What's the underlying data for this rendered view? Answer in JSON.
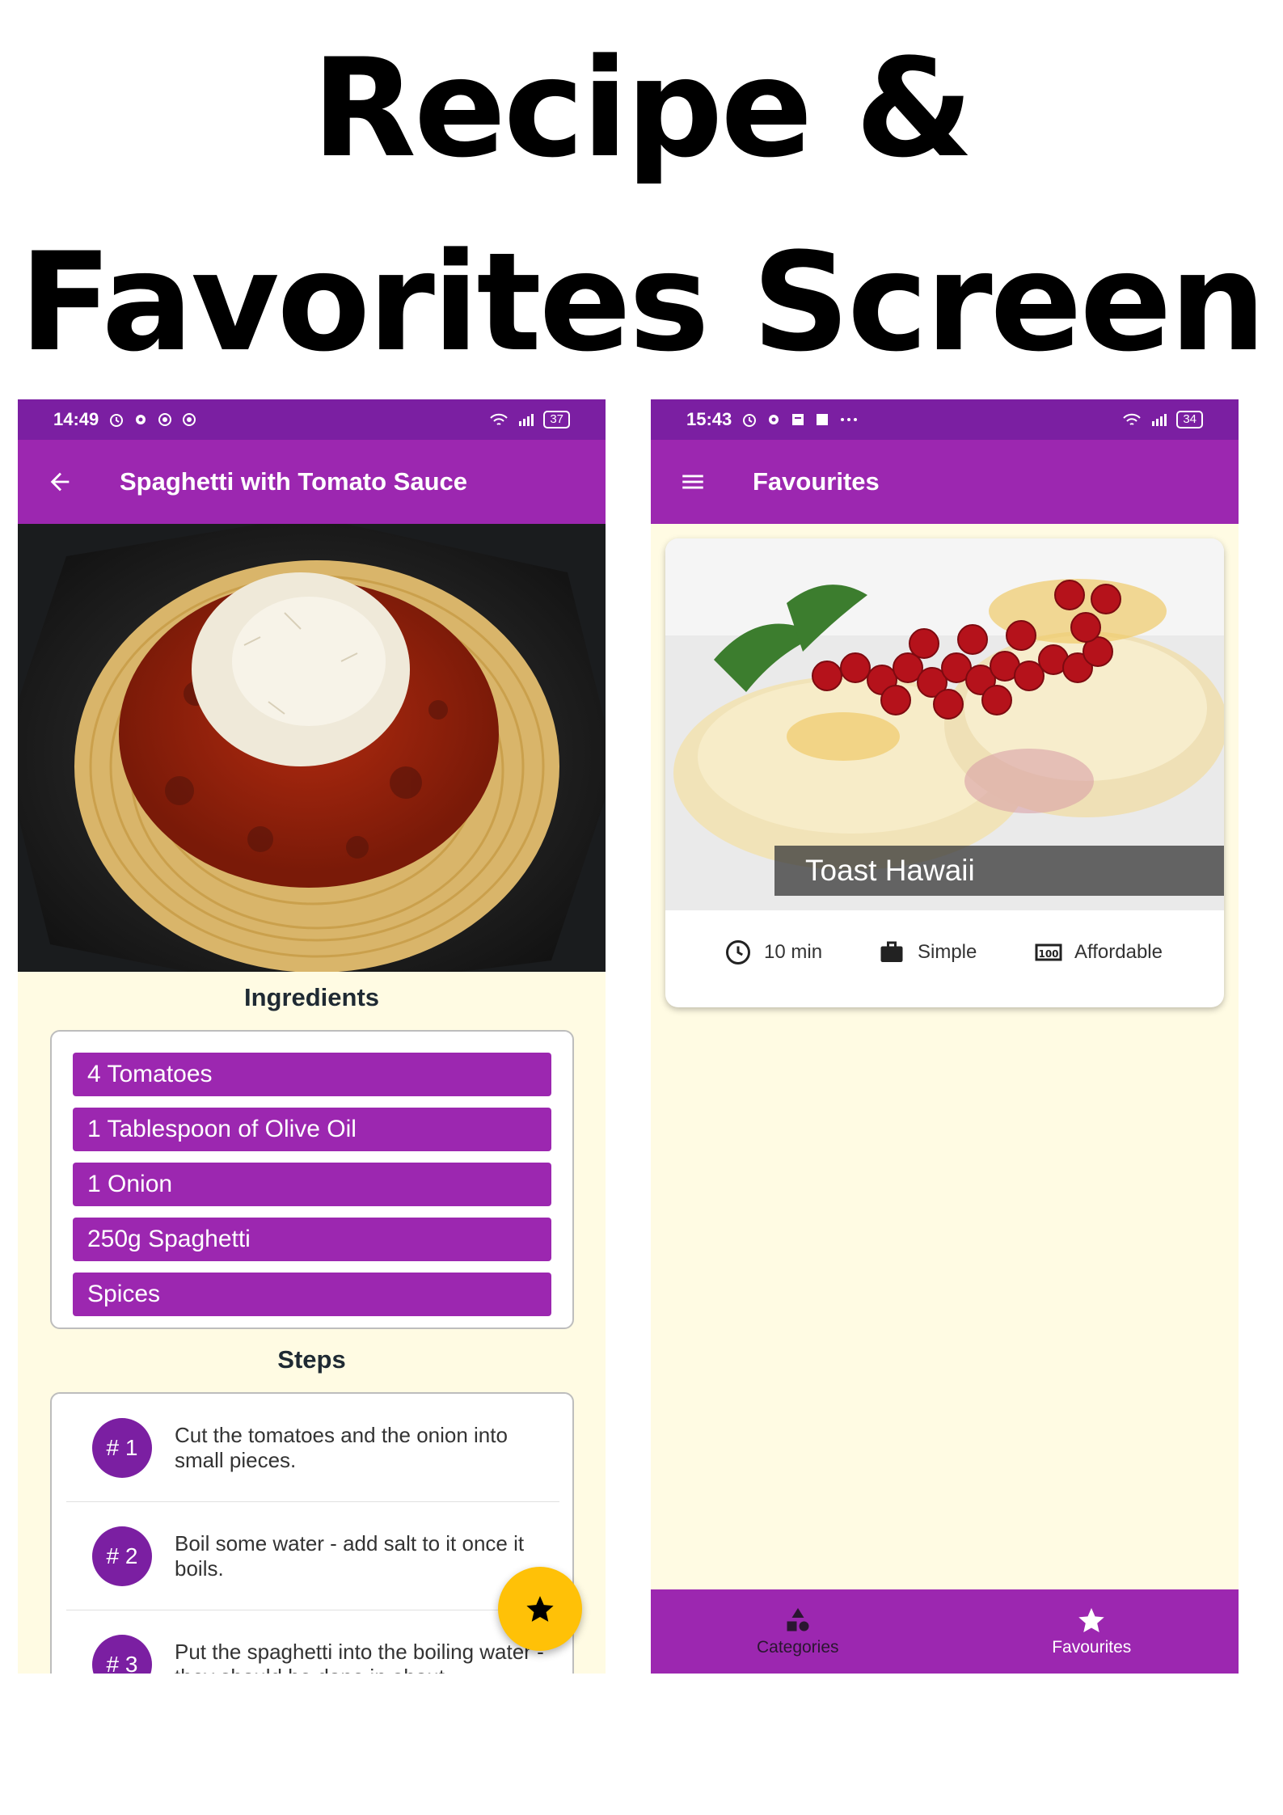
{
  "banner": {
    "line1": "Recipe &",
    "line2": "Favorites Screen"
  },
  "recipe_screen": {
    "status_bar": {
      "time": "14:49",
      "battery": "37"
    },
    "app_bar": {
      "title": "Spaghetti with Tomato Sauce",
      "nav_icon": "arrow-back-icon"
    },
    "ingredients_title": "Ingredients",
    "ingredients": [
      "4 Tomatoes",
      "1 Tablespoon of Olive Oil",
      "1 Onion",
      "250g Spaghetti",
      "Spices"
    ],
    "steps_title": "Steps",
    "steps": [
      {
        "badge": "# 1",
        "text": "Cut the tomatoes and the onion into small pieces."
      },
      {
        "badge": "# 2",
        "text": "Boil some water - add salt to it once it boils."
      },
      {
        "badge": "# 3",
        "text": "Put the spaghetti into the boiling water - they should be done in about"
      }
    ],
    "fab_icon": "star-icon"
  },
  "favourites_screen": {
    "status_bar": {
      "time": "15:43",
      "battery": "34"
    },
    "app_bar": {
      "title": "Favourites",
      "nav_icon": "menu-icon"
    },
    "meal": {
      "title": "Toast Hawaii",
      "duration": "10 min",
      "complexity": "Simple",
      "affordability": "Affordable"
    },
    "bottom_nav": [
      {
        "label": "Categories",
        "icon": "category-icon"
      },
      {
        "label": "Favourites",
        "icon": "star-icon"
      }
    ]
  },
  "colors": {
    "primary": "#9c27b0",
    "primary_dark": "#7b1fa2",
    "accent": "#ffc107",
    "background": "#fffbe3"
  }
}
